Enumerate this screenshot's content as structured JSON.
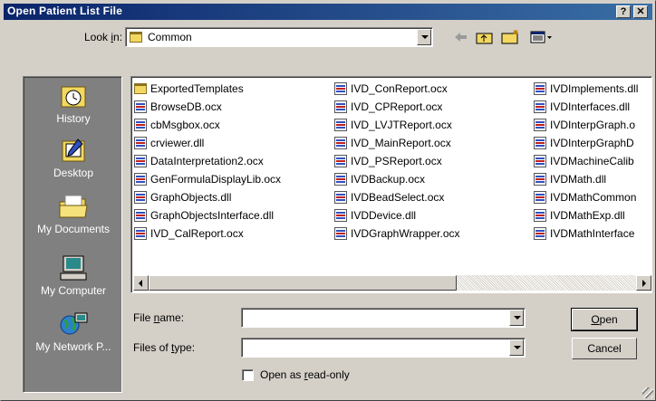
{
  "window": {
    "title": "Open Patient List File",
    "help_label": "?",
    "close_label": "✕"
  },
  "lookin": {
    "label_pre": "Look ",
    "label_u": "i",
    "label_post": "n:",
    "value": "Common"
  },
  "toolbar": {
    "back_icon": "back-arrow-icon",
    "up_icon": "up-folder-icon",
    "new_folder_icon": "new-folder-icon",
    "view_icon": "view-menu-icon"
  },
  "places": [
    {
      "label": "History",
      "icon": "history-icon"
    },
    {
      "label": "Desktop",
      "icon": "desktop-icon"
    },
    {
      "label": "My Documents",
      "icon": "my-documents-icon"
    },
    {
      "label": "My Computer",
      "icon": "my-computer-icon"
    },
    {
      "label": "My Network P...",
      "icon": "network-places-icon"
    }
  ],
  "files": {
    "col1": [
      "ExportedTemplates",
      "BrowseDB.ocx",
      "cbMsgbox.ocx",
      "crviewer.dll",
      "DataInterpretation2.ocx",
      "GenFormulaDisplayLib.ocx",
      "GraphObjects.dll",
      "GraphObjectsInterface.dll",
      "IVD_CalReport.ocx"
    ],
    "col2": [
      "IVD_ConReport.ocx",
      "IVD_CPReport.ocx",
      "IVD_LVJTReport.ocx",
      "IVD_MainReport.ocx",
      "IVD_PSReport.ocx",
      "IVDBackup.ocx",
      "IVDBeadSelect.ocx",
      "IVDDevice.dll",
      "IVDGraphWrapper.ocx"
    ],
    "col3": [
      "IVDImplements.dll",
      "IVDInterfaces.dll",
      "IVDInterpGraph.o",
      "IVDInterpGraphD",
      "IVDMachineCalib",
      "IVDMath.dll",
      "IVDMathCommon",
      "IVDMathExp.dll",
      "IVDMathInterface"
    ]
  },
  "filename": {
    "label_pre": "File ",
    "label_u": "n",
    "label_post": "ame:",
    "value": ""
  },
  "filetype": {
    "label_pre": "Files of ",
    "label_u": "t",
    "label_post": "ype:",
    "value": ""
  },
  "readonly": {
    "label_pre": "Open as ",
    "label_u": "r",
    "label_post": "ead-only",
    "checked": false
  },
  "buttons": {
    "open_u": "O",
    "open_post": "pen",
    "cancel": "Cancel"
  }
}
